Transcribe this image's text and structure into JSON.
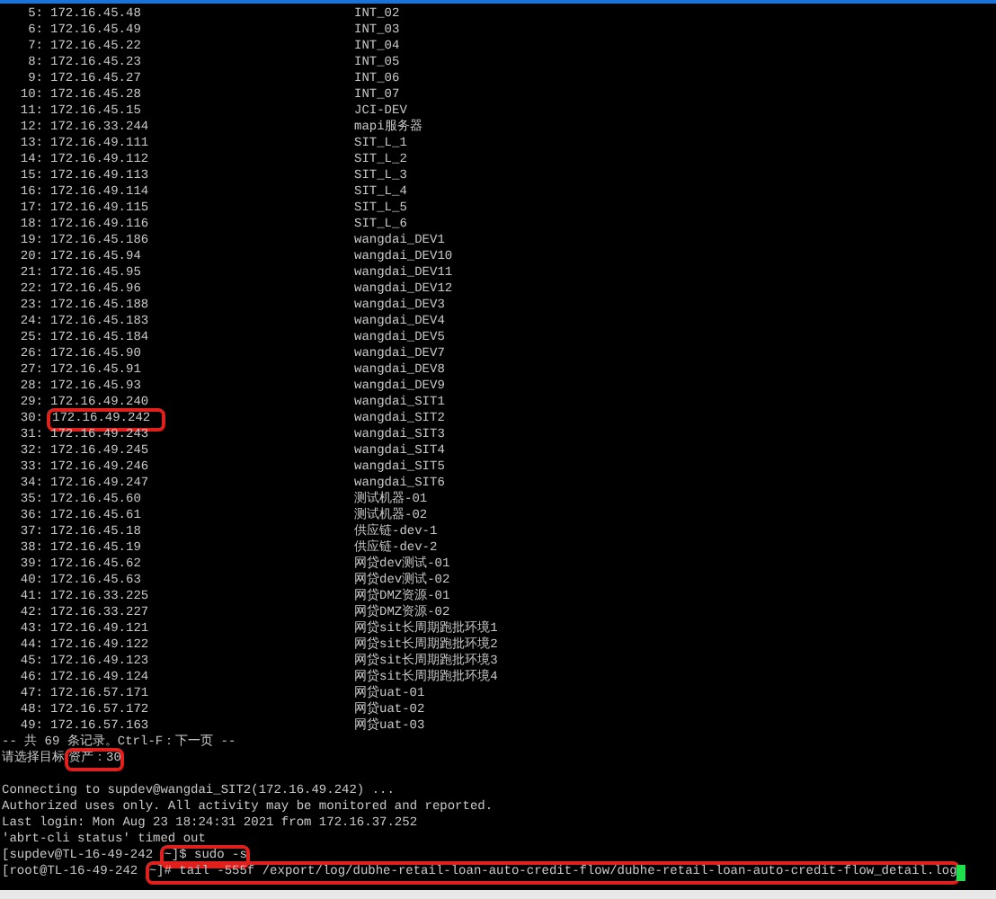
{
  "entries": [
    {
      "index": "5:",
      "ip": "172.16.45.48",
      "name": "INT_02",
      "highlighted": false
    },
    {
      "index": "6:",
      "ip": "172.16.45.49",
      "name": "INT_03",
      "highlighted": false
    },
    {
      "index": "7:",
      "ip": "172.16.45.22",
      "name": "INT_04",
      "highlighted": false
    },
    {
      "index": "8:",
      "ip": "172.16.45.23",
      "name": "INT_05",
      "highlighted": false
    },
    {
      "index": "9:",
      "ip": "172.16.45.27",
      "name": "INT_06",
      "highlighted": false
    },
    {
      "index": "10:",
      "ip": "172.16.45.28",
      "name": "INT_07",
      "highlighted": false
    },
    {
      "index": "11:",
      "ip": "172.16.45.15",
      "name": "JCI-DEV",
      "highlighted": false
    },
    {
      "index": "12:",
      "ip": "172.16.33.244",
      "name": "mapi服务器",
      "highlighted": false
    },
    {
      "index": "13:",
      "ip": "172.16.49.111",
      "name": "SIT_L_1",
      "highlighted": false
    },
    {
      "index": "14:",
      "ip": "172.16.49.112",
      "name": "SIT_L_2",
      "highlighted": false
    },
    {
      "index": "15:",
      "ip": "172.16.49.113",
      "name": "SIT_L_3",
      "highlighted": false
    },
    {
      "index": "16:",
      "ip": "172.16.49.114",
      "name": "SIT_L_4",
      "highlighted": false
    },
    {
      "index": "17:",
      "ip": "172.16.49.115",
      "name": "SIT_L_5",
      "highlighted": false
    },
    {
      "index": "18:",
      "ip": "172.16.49.116",
      "name": "SIT_L_6",
      "highlighted": false
    },
    {
      "index": "19:",
      "ip": "172.16.45.186",
      "name": "wangdai_DEV1",
      "highlighted": false
    },
    {
      "index": "20:",
      "ip": "172.16.45.94",
      "name": "wangdai_DEV10",
      "highlighted": false
    },
    {
      "index": "21:",
      "ip": "172.16.45.95",
      "name": "wangdai_DEV11",
      "highlighted": false
    },
    {
      "index": "22:",
      "ip": "172.16.45.96",
      "name": "wangdai_DEV12",
      "highlighted": false
    },
    {
      "index": "23:",
      "ip": "172.16.45.188",
      "name": "wangdai_DEV3",
      "highlighted": false
    },
    {
      "index": "24:",
      "ip": "172.16.45.183",
      "name": "wangdai_DEV4",
      "highlighted": false
    },
    {
      "index": "25:",
      "ip": "172.16.45.184",
      "name": "wangdai_DEV5",
      "highlighted": false
    },
    {
      "index": "26:",
      "ip": "172.16.45.90",
      "name": "wangdai_DEV7",
      "highlighted": false
    },
    {
      "index": "27:",
      "ip": "172.16.45.91",
      "name": "wangdai_DEV8",
      "highlighted": false
    },
    {
      "index": "28:",
      "ip": "172.16.45.93",
      "name": "wangdai_DEV9",
      "highlighted": false
    },
    {
      "index": "29:",
      "ip": "172.16.49.240",
      "name": "wangdai_SIT1",
      "highlighted": false
    },
    {
      "index": "30:",
      "ip": "172.16.49.242",
      "name": "wangdai_SIT2",
      "highlighted": true
    },
    {
      "index": "31:",
      "ip": "172.16.49.243",
      "name": "wangdai_SIT3",
      "highlighted": false
    },
    {
      "index": "32:",
      "ip": "172.16.49.245",
      "name": "wangdai_SIT4",
      "highlighted": false
    },
    {
      "index": "33:",
      "ip": "172.16.49.246",
      "name": "wangdai_SIT5",
      "highlighted": false
    },
    {
      "index": "34:",
      "ip": "172.16.49.247",
      "name": "wangdai_SIT6",
      "highlighted": false
    },
    {
      "index": "35:",
      "ip": "172.16.45.60",
      "name": "测试机器-01",
      "highlighted": false
    },
    {
      "index": "36:",
      "ip": "172.16.45.61",
      "name": "测试机器-02",
      "highlighted": false
    },
    {
      "index": "37:",
      "ip": "172.16.45.18",
      "name": "供应链-dev-1",
      "highlighted": false
    },
    {
      "index": "38:",
      "ip": "172.16.45.19",
      "name": "供应链-dev-2",
      "highlighted": false
    },
    {
      "index": "39:",
      "ip": "172.16.45.62",
      "name": "网贷dev测试-01",
      "highlighted": false
    },
    {
      "index": "40:",
      "ip": "172.16.45.63",
      "name": "网贷dev测试-02",
      "highlighted": false
    },
    {
      "index": "41:",
      "ip": "172.16.33.225",
      "name": "网贷DMZ资源-01",
      "highlighted": false
    },
    {
      "index": "42:",
      "ip": "172.16.33.227",
      "name": "网贷DMZ资源-02",
      "highlighted": false
    },
    {
      "index": "43:",
      "ip": "172.16.49.121",
      "name": "网贷sit长周期跑批环境1",
      "highlighted": false
    },
    {
      "index": "44:",
      "ip": "172.16.49.122",
      "name": "网贷sit长周期跑批环境2",
      "highlighted": false
    },
    {
      "index": "45:",
      "ip": "172.16.49.123",
      "name": "网贷sit长周期跑批环境3",
      "highlighted": false
    },
    {
      "index": "46:",
      "ip": "172.16.49.124",
      "name": "网贷sit长周期跑批环境4",
      "highlighted": false
    },
    {
      "index": "47:",
      "ip": "172.16.57.171",
      "name": "网贷uat-01",
      "highlighted": false
    },
    {
      "index": "48:",
      "ip": "172.16.57.172",
      "name": "网贷uat-02",
      "highlighted": false
    },
    {
      "index": "49:",
      "ip": "172.16.57.163",
      "name": "网贷uat-03",
      "highlighted": false
    }
  ],
  "pager_lines": [
    {
      "segments": [
        {
          "text": "-- 共 69 条记录。Ctrl-F：下一页 --",
          "boxed": false
        }
      ]
    },
    {
      "segments": [
        {
          "text": "请选择目标",
          "boxed": false
        },
        {
          "text": "资产：30",
          "boxed": true
        }
      ]
    }
  ],
  "session_lines": [
    {
      "segments": [
        {
          "text": "Connecting to supdev@wangdai_SIT2(172.16.49.242) ...",
          "boxed": false
        }
      ],
      "cursor": false
    },
    {
      "segments": [
        {
          "text": "Authorized uses only. All activity may be monitored and reported.",
          "boxed": false
        }
      ],
      "cursor": false
    },
    {
      "segments": [
        {
          "text": "Last login: Mon Aug 23 18:24:31 2021 from 172.16.37.252",
          "boxed": false
        }
      ],
      "cursor": false
    },
    {
      "segments": [
        {
          "text": "'abrt-cli status' timed out",
          "boxed": false
        }
      ],
      "cursor": false
    },
    {
      "segments": [
        {
          "text": "[supdev@TL-16-49-242 ",
          "boxed": false
        },
        {
          "text": "~]$ sudo -s",
          "boxed": true
        }
      ],
      "cursor": false
    },
    {
      "segments": [
        {
          "text": "[root@TL-16-49-242 ",
          "boxed": false
        },
        {
          "text": "~]# tail -555f /export/log/dubhe-retail-loan-auto-credit-flow/dubhe-retail-loan-auto-credit-flow_detail.log",
          "boxed": true
        }
      ],
      "cursor": true
    }
  ]
}
